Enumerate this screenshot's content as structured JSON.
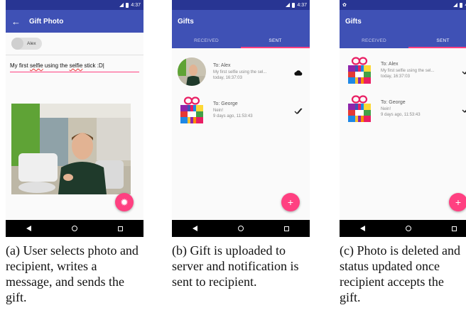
{
  "status_bar": {
    "time": "4:37"
  },
  "screen_a": {
    "title": "Gift Photo",
    "recipient_chip": "Alex",
    "message_parts": [
      "My first ",
      "selfie",
      " using the ",
      "selfie",
      " stick :D|"
    ],
    "caption": "(a) User selects photo and recipient, writes a message, and sends the gift."
  },
  "screen_b": {
    "title": "Gifts",
    "tabs": [
      "RECEIVED",
      "SENT"
    ],
    "active_tab": "SENT",
    "items": [
      {
        "to": "To: Alex",
        "message": "My first selfie using the sel...",
        "time": "today, 16:37:03",
        "status_icon": "cloud-icon"
      },
      {
        "to": "To: George",
        "message": "Nein!",
        "time": "9 days ago, 11:53:43",
        "status_icon": "double-check-icon"
      }
    ],
    "caption": "(b) Gift is uploaded to server and notification is sent to recipient."
  },
  "screen_c": {
    "title": "Gifts",
    "tabs": [
      "RECEIVED",
      "SENT"
    ],
    "active_tab": "SENT",
    "items": [
      {
        "to": "To: Alex",
        "message": "My first selfie using the sel...",
        "time": "today, 16:37:03",
        "status_icon": "double-check-icon"
      },
      {
        "to": "To: George",
        "message": "Nein!",
        "time": "9 days ago, 11:53:43",
        "status_icon": "double-check-icon"
      }
    ],
    "caption": "(c) Photo is deleted and status updated once recipient accepts the gift."
  },
  "colors": {
    "primary": "#3f51b5",
    "primary_dark": "#283593",
    "accent": "#ff4081"
  }
}
